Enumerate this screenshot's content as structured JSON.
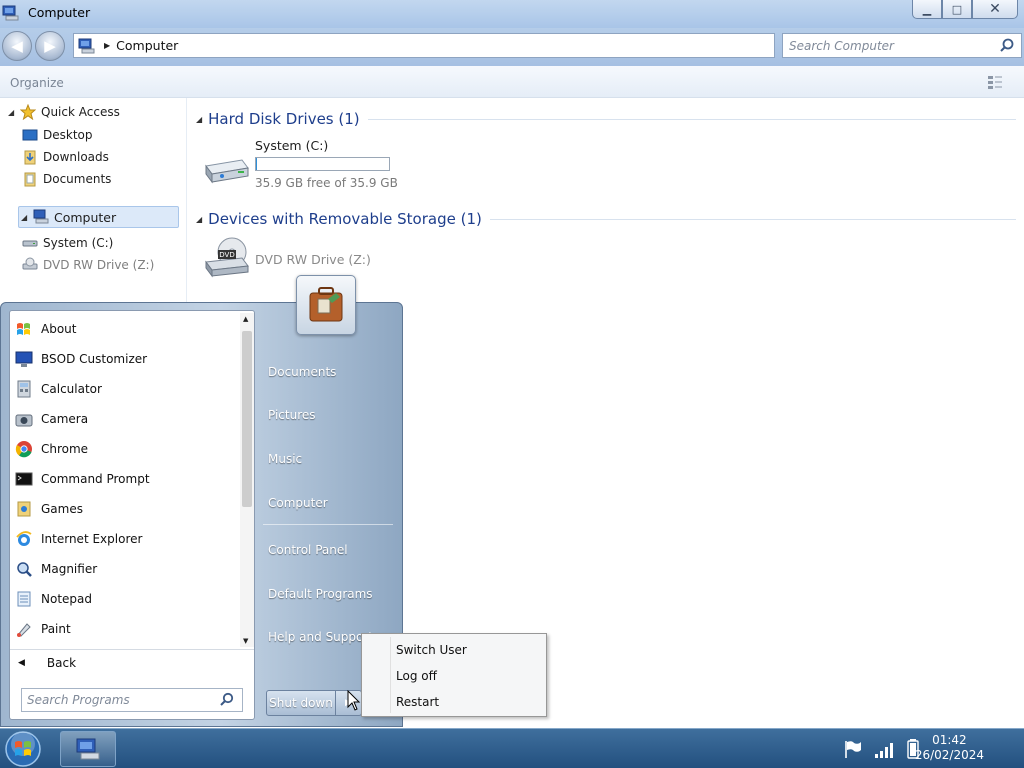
{
  "window": {
    "title": "Computer",
    "minimize_label": "▁",
    "maximize_label": "□",
    "close_label": "✕"
  },
  "navigation": {
    "address": "Computer",
    "search_placeholder": "Search Computer"
  },
  "toolbar": {
    "organize_label": "Organize"
  },
  "nav_pane": {
    "quick_access": "Quick Access",
    "desktop": "Desktop",
    "downloads": "Downloads",
    "documents": "Documents",
    "computer": "Computer",
    "system_c": "System (C:)",
    "dvd_drive": "DVD RW Drive (Z:)"
  },
  "content": {
    "hard_disk_group": "Hard Disk Drives (1)",
    "drive_c_name": "System (C:)",
    "drive_c_free": "35.9 GB free of 35.9 GB",
    "drive_c_used_fraction": 0.005,
    "removable_group": "Devices with Removable Storage (1)",
    "dvd_name": "DVD RW Drive (Z:)"
  },
  "start_menu": {
    "programs": [
      {
        "label": "About",
        "icon": "windows-flag-icon"
      },
      {
        "label": "BSOD Customizer",
        "icon": "monitor-icon"
      },
      {
        "label": "Calculator",
        "icon": "calculator-icon"
      },
      {
        "label": "Camera",
        "icon": "camera-icon"
      },
      {
        "label": "Chrome",
        "icon": "chrome-icon"
      },
      {
        "label": "Command Prompt",
        "icon": "terminal-icon"
      },
      {
        "label": "Games",
        "icon": "games-folder-icon"
      },
      {
        "label": "Internet Explorer",
        "icon": "internet-explorer-icon"
      },
      {
        "label": "Magnifier",
        "icon": "magnifier-icon"
      },
      {
        "label": "Notepad",
        "icon": "notepad-icon"
      },
      {
        "label": "Paint",
        "icon": "paint-icon"
      }
    ],
    "back_label": "Back",
    "search_placeholder": "Search Programs",
    "right_links": {
      "documents": "Documents",
      "pictures": "Pictures",
      "music": "Music",
      "computer": "Computer",
      "control_panel": "Control Panel",
      "default_programs": "Default Programs",
      "help_support": "Help and Support"
    },
    "shutdown_label": "Shut down"
  },
  "shutdown_menu": {
    "switch_user": "Switch User",
    "log_off": "Log off",
    "restart": "Restart"
  },
  "taskbar": {
    "time": "01:42",
    "date": "26/02/2024"
  }
}
